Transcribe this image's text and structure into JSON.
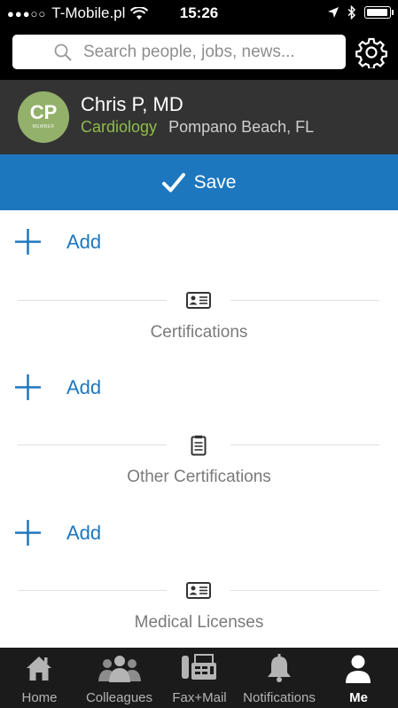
{
  "status_bar": {
    "carrier": "T-Mobile.pl",
    "time": "15:26"
  },
  "search": {
    "placeholder": "Search people, jobs, news..."
  },
  "profile": {
    "avatar_initials": "CP",
    "avatar_sublabel": "MEMBER",
    "name": "Chris P, MD",
    "specialty": "Cardiology",
    "location": "Pompano Beach, FL"
  },
  "save_label": "Save",
  "sections": [
    {
      "add_label": "Add",
      "title": "Certifications",
      "icon": "id-card-icon"
    },
    {
      "add_label": "Add",
      "title": "Other Certifications",
      "icon": "clipboard-icon"
    },
    {
      "add_label": "Add",
      "title": "Medical Licenses",
      "icon": "id-card-icon"
    }
  ],
  "tabs": [
    {
      "label": "Home",
      "icon": "home-icon"
    },
    {
      "label": "Colleagues",
      "icon": "colleagues-icon"
    },
    {
      "label": "Fax+Mail",
      "icon": "fax-icon"
    },
    {
      "label": "Notifications",
      "icon": "bell-icon"
    },
    {
      "label": "Me",
      "icon": "person-icon",
      "active": true
    }
  ],
  "colors": {
    "brand_blue": "#1d77bf",
    "specialty_green": "#8ebd4c",
    "avatar_green": "#93b16a",
    "profile_bg": "#333333",
    "tabbar_bg": "#1b1b1b"
  }
}
